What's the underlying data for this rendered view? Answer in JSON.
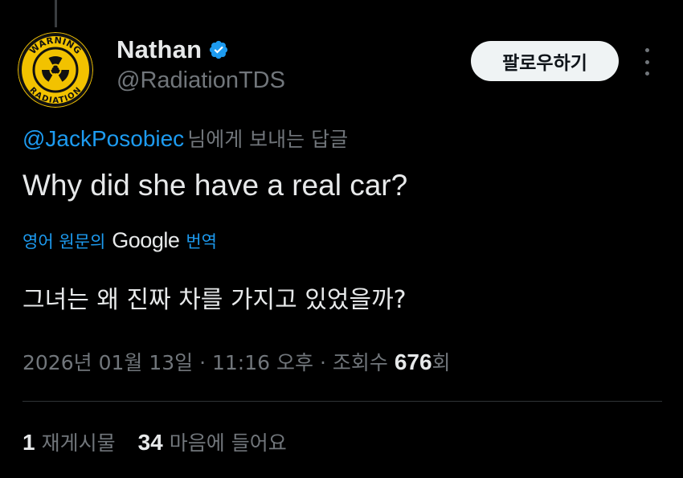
{
  "author": {
    "name": "Nathan",
    "handle": "@RadiationTDS",
    "verified": true,
    "avatar_icon": "warning-radiation-icon",
    "avatar_top_text": "WARNING",
    "avatar_bottom_text": "RADIATION"
  },
  "follow_label": "팔로우하기",
  "more_icon": "more-vertical-icon",
  "reply_to": {
    "mention": "@JackPosobiec",
    "suffix": "님에게 보내는 답글"
  },
  "tweet_text": "Why did she have a real car?",
  "translation": {
    "prefix": "영어 원문의",
    "provider": "Google",
    "suffix": "번역",
    "text": "그녀는 왜 진짜 차를 가지고 있었을까?"
  },
  "meta": {
    "date": "2026년 01월 13일",
    "time": "11:16 오후",
    "views_label": "조회수",
    "views_count": "676",
    "views_suffix": "회"
  },
  "stats": {
    "reposts_count": "1",
    "reposts_label": "재게시물",
    "likes_count": "34",
    "likes_label": "마음에 들어요"
  },
  "colors": {
    "background": "#000000",
    "text_primary": "#e7e9ea",
    "text_secondary": "#71767b",
    "accent_blue": "#1d9bf0",
    "avatar_yellow": "#f2c200",
    "divider": "#2f3336"
  }
}
